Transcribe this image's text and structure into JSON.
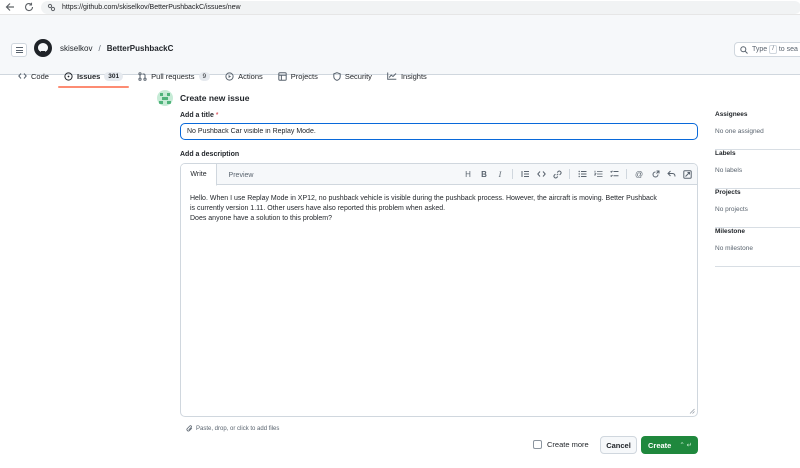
{
  "browser": {
    "url": "https://github.com/skiselkov/BetterPushbackC/issues/new"
  },
  "header": {
    "owner": "skiselkov",
    "separator": "/",
    "repo": "BetterPushbackC",
    "search_prefix": "Type",
    "search_key": "/",
    "search_suffix": "to sea"
  },
  "nav": {
    "code": "Code",
    "issues": "Issues",
    "issues_count": "301",
    "pulls": "Pull requests",
    "pulls_count": "9",
    "actions": "Actions",
    "projects": "Projects",
    "security": "Security",
    "insights": "Insights"
  },
  "form": {
    "heading": "Create new issue",
    "title_label": "Add a title",
    "required_mark": "*",
    "title_value": "No Pushback Car visible in Replay Mode.",
    "description_label": "Add a description",
    "tab_write": "Write",
    "tab_preview": "Preview",
    "body": "Hello. When I use Replay Mode in XP12, no pushback vehicle is visible during the pushback process. However, the aircraft is moving. Better Pushback\nis currently version 1.11. Other users have also reported this problem when asked.\nDoes anyone have a solution to this problem?",
    "attach_hint": "Paste, drop, or click to add files",
    "create_more": "Create more",
    "cancel": "Cancel",
    "create": "Create",
    "create_hotkey": "⌃ ↵"
  },
  "sidebar": {
    "assignees": "Assignees",
    "assignees_value": "No one assigned",
    "labels": "Labels",
    "labels_value": "No labels",
    "projects": "Projects",
    "projects_value": "No projects",
    "milestone": "Milestone",
    "milestone_value": "No milestone"
  },
  "colors": {
    "accent_blue": "#0969da",
    "create_green": "#1f883d",
    "active_tab_underline": "#fd8c73"
  }
}
